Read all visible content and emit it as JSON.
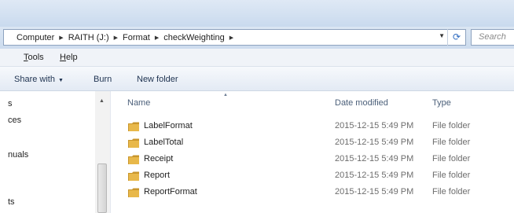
{
  "address": {
    "breadcrumbs": [
      "Computer",
      "RAITH (J:)",
      "Format",
      "checkWeighting"
    ]
  },
  "search": {
    "placeholder": "Search"
  },
  "menu": {
    "tools": "Tools",
    "help": "Help"
  },
  "commands": {
    "share": "Share with",
    "burn": "Burn",
    "new_folder": "New folder"
  },
  "nav": {
    "items": [
      "s",
      "ces",
      "nuals",
      "ts"
    ]
  },
  "columns": {
    "name": "Name",
    "date": "Date modified",
    "type": "Type"
  },
  "files": [
    {
      "name": "LabelFormat",
      "date": "2015-12-15 5:49 PM",
      "type": "File folder"
    },
    {
      "name": "LabelTotal",
      "date": "2015-12-15 5:49 PM",
      "type": "File folder"
    },
    {
      "name": "Receipt",
      "date": "2015-12-15 5:49 PM",
      "type": "File folder"
    },
    {
      "name": "Report",
      "date": "2015-12-15 5:49 PM",
      "type": "File folder"
    },
    {
      "name": "ReportFormat",
      "date": "2015-12-15 5:49 PM",
      "type": "File folder"
    }
  ],
  "colors": {
    "folder": "#e8b84a",
    "folder_dark": "#c9962c",
    "header_text": "#4c607a"
  }
}
